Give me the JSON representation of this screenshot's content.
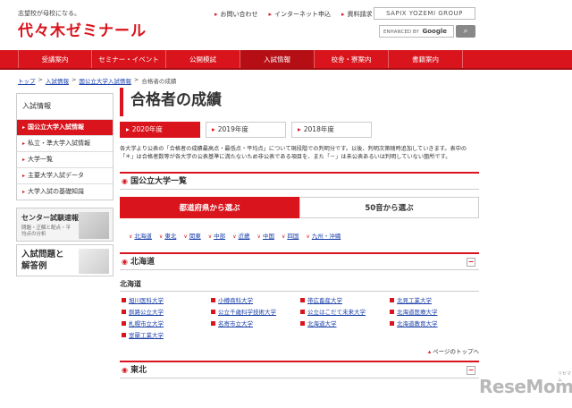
{
  "header": {
    "tagline": "志望校が母校になる。",
    "logo": "代々木ゼミナール",
    "top_links": [
      "お問い合わせ",
      "インターネット申込",
      "資料請求"
    ],
    "sapix": "SAPIX YOZEMI GROUP",
    "search_placeholder": "ENHANCED BY Google",
    "search_google": "Google",
    "search_icon": "magnifier-icon"
  },
  "nav": {
    "items": [
      "受講案内",
      "セミナー・イベント",
      "公開模試",
      "入試情報",
      "校舎・寮案内",
      "書籍案内"
    ],
    "active_index": 3
  },
  "breadcrumb": {
    "home": "トップ",
    "sep": ">",
    "level1": "入試情報",
    "level2": "国公立大学入試情報",
    "current": "合格者の成績"
  },
  "sidebar": {
    "title": "入試情報",
    "items": [
      "国公立大学入試情報",
      "私立・準大学入試情報",
      "大学一覧",
      "主要大学入試データ",
      "大学入試の基礎知識"
    ],
    "active_index": 0,
    "banner1_title": "センター試験速報",
    "banner1_sub": "問題・正解と配点・平均点の分析",
    "banner2_line1": "入試問題と",
    "banner2_line2": "解答例"
  },
  "main": {
    "title": "合格者の成績",
    "years": [
      "2020年度",
      "2019年度",
      "2018年度"
    ],
    "active_year": 0,
    "notice": "各大学より公表の「合格者の成績最高点・最低点・平均点」について現段階での判明分です。以後、判明次第随時追加していきます。表中の「＊」は合格者数等が各大学の公表基準に満たないため非公表である項目を、また「－」は未公表あるいは判明していない箇所です。",
    "section_list_title": "国公立大学一覧",
    "tab_pref": "都道府県から選ぶ",
    "tab_kana": "50音から選ぶ",
    "regions": [
      "北海道",
      "東北",
      "関東",
      "中部",
      "近畿",
      "中国",
      "四国",
      "九州・沖縄"
    ],
    "hokkaido_section": "北海道",
    "hokkaido_sub": "北海道",
    "universities": [
      "旭川医科大学",
      "小樽商科大学",
      "帯広畜産大学",
      "北見工業大学",
      "釧路公立大学",
      "公立千歳科学技術大学",
      "公立はこだて未来大学",
      "北海道医療大学",
      "札幌市立大学",
      "名寄市立大学",
      "北海道大学",
      "北海道教育大学",
      "室蘭工業大学"
    ],
    "page_top": "ページのトップへ",
    "tohoku_section": "東北"
  },
  "watermark": {
    "text": "ReseMom",
    "ruby": "リセマム"
  },
  "colors": {
    "brand_red": "#d9141c",
    "link_blue": "#1a3fa8"
  }
}
